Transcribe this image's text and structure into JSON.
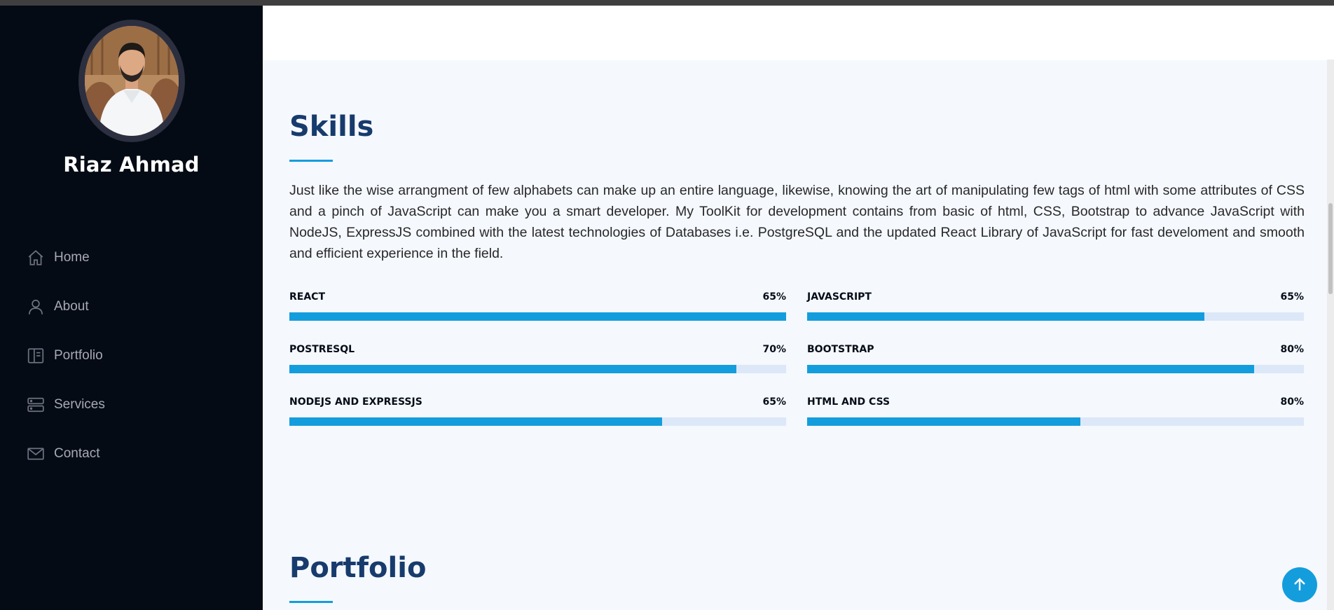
{
  "sidebar": {
    "name": "Riaz Ahmad",
    "nav": [
      {
        "label": "Home",
        "icon": "house-icon"
      },
      {
        "label": "About",
        "icon": "person-icon"
      },
      {
        "label": "Portfolio",
        "icon": "portfolio-icon"
      },
      {
        "label": "Services",
        "icon": "server-icon"
      },
      {
        "label": "Contact",
        "icon": "envelope-icon"
      }
    ]
  },
  "skills": {
    "title": "Skills",
    "description": "Just like the wise arrangment of few alphabets can make up an entire language, likewise, knowing the art of manipulating few tags of html with some attributes of CSS and a pinch of JavaScript can make you a smart developer. My ToolKit for development contains from basic of html, CSS, Bootstrap to advance JavaScript with NodeJS, ExpressJS combined with the latest technologies of Databases i.e. PostgreSQL and the updated React Library of JavaScript for fast develoment and smooth and efficient experience in the field.",
    "items": [
      {
        "name": "REACT",
        "percent_label": "65%",
        "fill": 1.0
      },
      {
        "name": "JAVASCRIPT",
        "percent_label": "65%",
        "fill": 0.8
      },
      {
        "name": "POSTRESQL",
        "percent_label": "70%",
        "fill": 0.9
      },
      {
        "name": "BOOTSTRAP",
        "percent_label": "80%",
        "fill": 0.9
      },
      {
        "name": "NODEJS AND EXPRESSJS",
        "percent_label": "65%",
        "fill": 0.75
      },
      {
        "name": "HTML AND CSS",
        "percent_label": "80%",
        "fill": 0.55
      }
    ]
  },
  "portfolio": {
    "title": "Portfolio"
  },
  "colors": {
    "accent": "#149ddd",
    "sidebar_bg": "#040b14",
    "heading": "#173b6c",
    "track": "#dce8f8"
  },
  "back_to_top": {
    "icon": "arrow-up-icon"
  }
}
